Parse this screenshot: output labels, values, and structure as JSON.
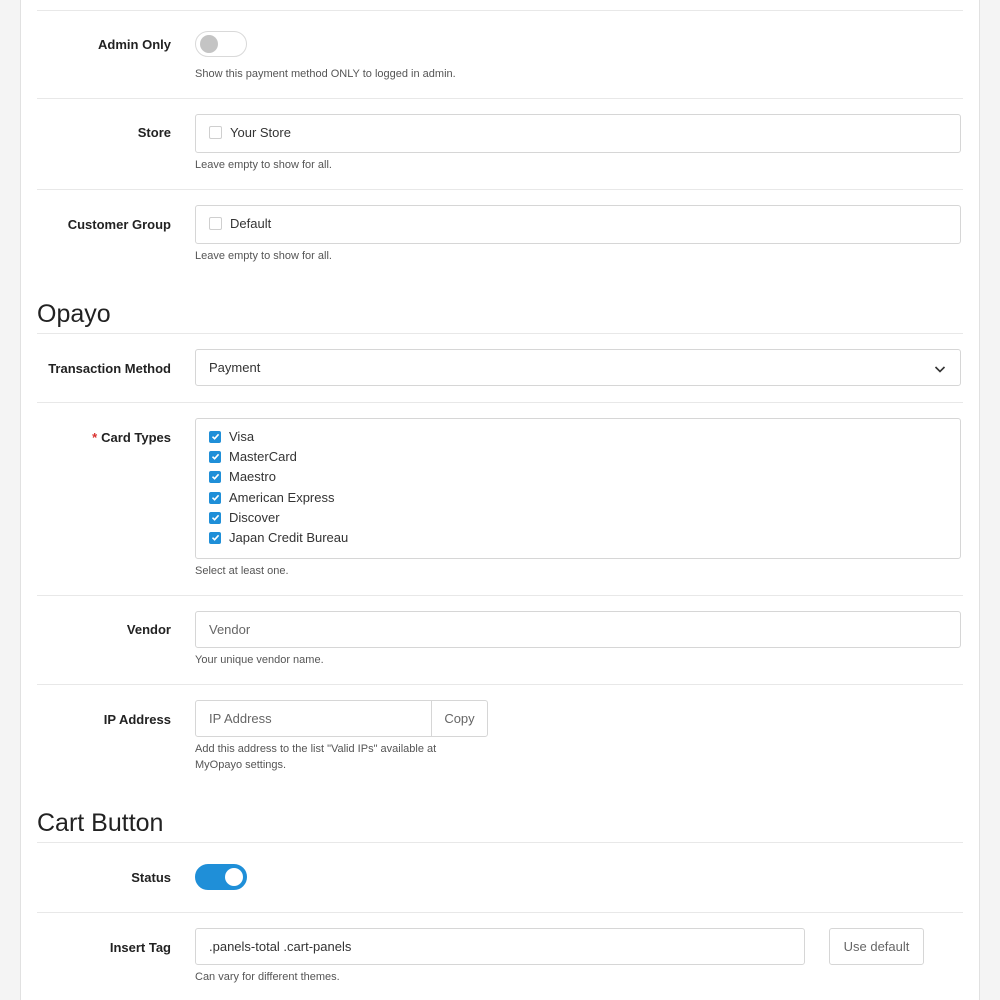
{
  "admin_only": {
    "label": "Admin Only",
    "enabled": false,
    "help": "Show this payment method ONLY to logged in admin."
  },
  "store": {
    "label": "Store",
    "option": "Your Store",
    "checked": false,
    "help": "Leave empty to show for all."
  },
  "customer_group": {
    "label": "Customer Group",
    "option": "Default",
    "checked": false,
    "help": "Leave empty to show for all."
  },
  "opayo": {
    "title": "Opayo",
    "transaction_method": {
      "label": "Transaction Method",
      "value": "Payment"
    },
    "card_types": {
      "required_mark": "*",
      "label": "Card Types",
      "items": [
        {
          "label": "Visa",
          "checked": true
        },
        {
          "label": "MasterCard",
          "checked": true
        },
        {
          "label": "Maestro",
          "checked": true
        },
        {
          "label": "American Express",
          "checked": true
        },
        {
          "label": "Discover",
          "checked": true
        },
        {
          "label": "Japan Credit Bureau",
          "checked": true
        }
      ],
      "help": "Select at least one."
    },
    "vendor": {
      "label": "Vendor",
      "placeholder": "Vendor",
      "help": "Your unique vendor name."
    },
    "ip_address": {
      "label": "IP Address",
      "placeholder": "IP Address",
      "copy_button": "Copy",
      "help_line1": "Add this address to the list \"Valid IPs\" available at",
      "help_line2": "MyOpayo settings."
    }
  },
  "cart_button": {
    "title": "Cart Button",
    "status": {
      "label": "Status",
      "enabled": true
    },
    "insert_tag": {
      "label": "Insert Tag",
      "value": ".panels-total .cart-panels",
      "default_button": "Use default",
      "help": "Can vary for different themes."
    }
  },
  "colors": {
    "accent": "#1f8fd8",
    "required": "#d9302e"
  }
}
